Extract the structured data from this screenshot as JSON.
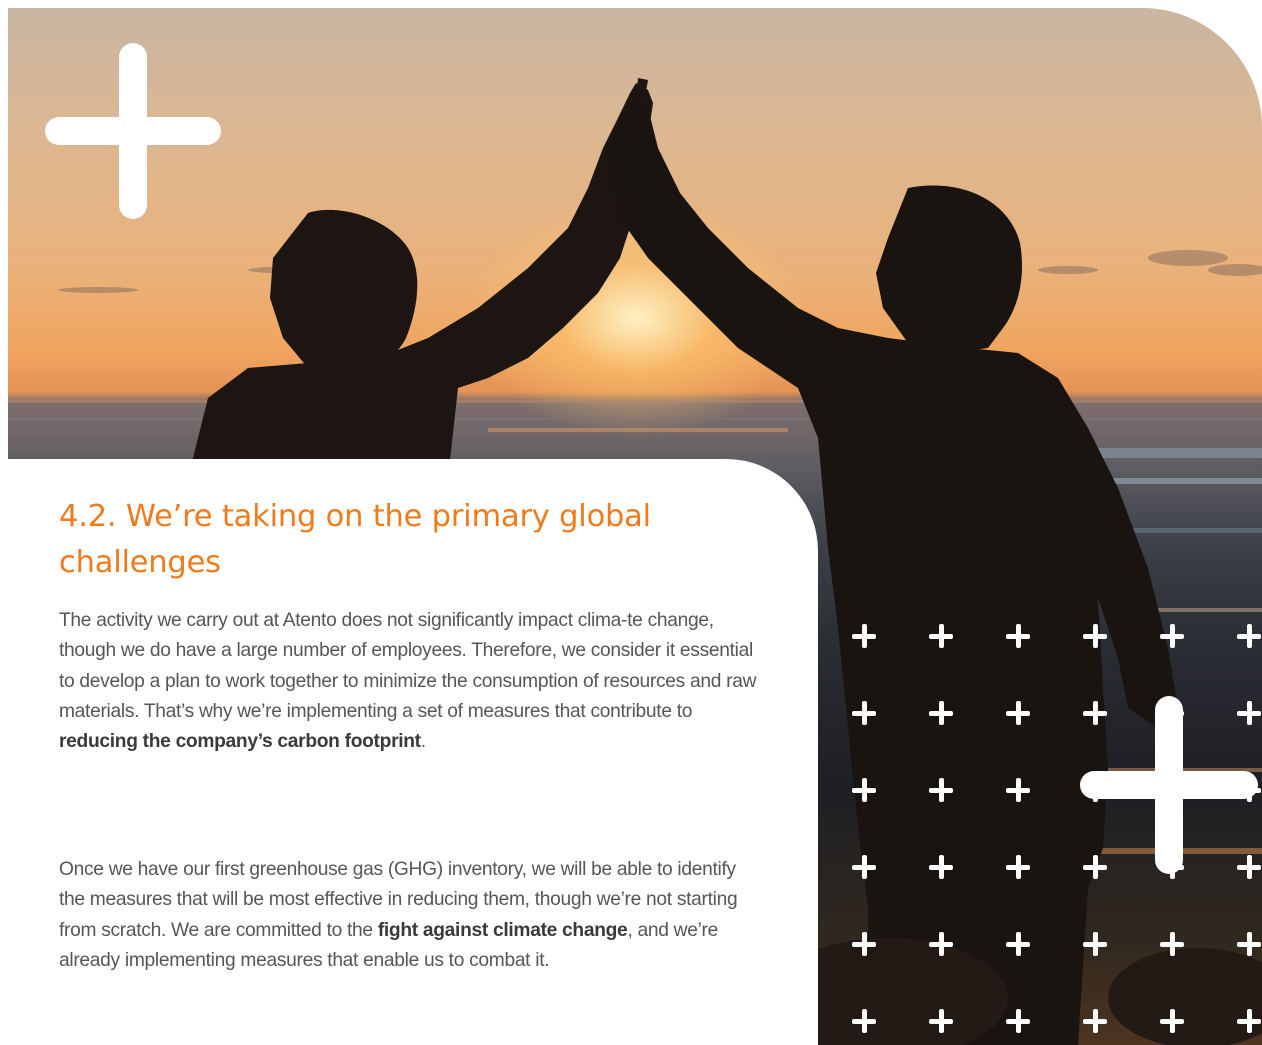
{
  "section": {
    "number": "4.2.",
    "title": "We’re taking on the primary global challenges",
    "title_color": "#f07b1d"
  },
  "paragraphs": [
    {
      "before": "The activity we carry out at Atento does not significantly impact clima-te change, though we do have a large number of employees. Therefore, we consider it essential to develop a plan to work together to minimize the consumption of resources and raw materials. That’s why we’re implementing a set of measures that contribute to ",
      "bold": "reducing the company’s carbon footprint",
      "after": "."
    },
    {
      "before": "Once we have our first greenhouse gas (GHG) inventory, we will be able to identify the measures that will be most effective in reducing them, though we’re not starting from scratch. We are committed to the ",
      "bold": "fight against climate change",
      "after": ", and we’re already implementing measures that enable us to combat it."
    }
  ],
  "hero_image": {
    "icon": "two-people-high-five-at-sunset-photo"
  },
  "decorations": {
    "large_plus_icons": 2,
    "plus_grid_rows": 6,
    "plus_grid_cols": 6
  }
}
